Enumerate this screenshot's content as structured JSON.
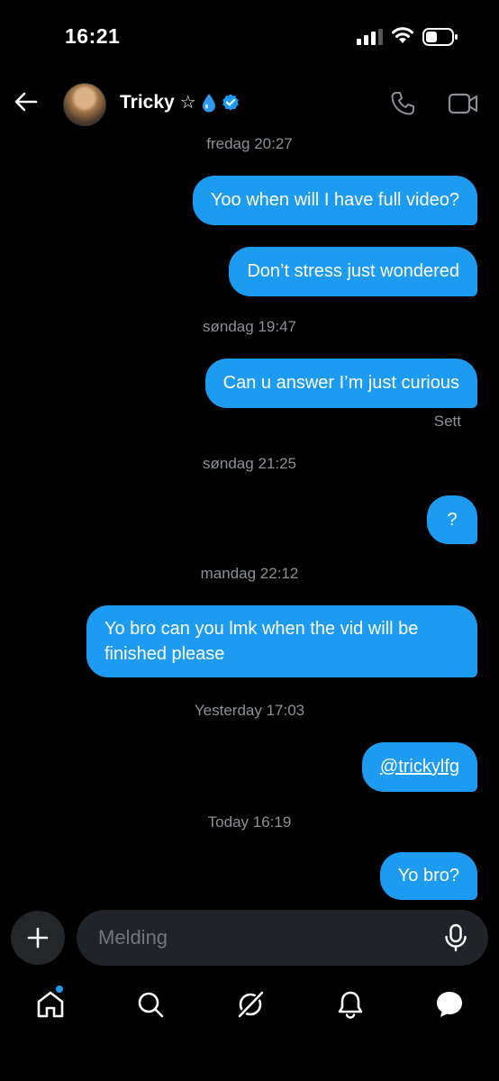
{
  "status_bar": {
    "time": "16:21"
  },
  "header": {
    "contact_name": "Tricky",
    "name_emoji_star": "☆",
    "verified": true
  },
  "messages": [
    {
      "type": "timestamp",
      "text": "fredag 20:27"
    },
    {
      "type": "sent",
      "text": "Yoo when will I have full video?"
    },
    {
      "type": "sent",
      "text": "Don’t stress just wondered"
    },
    {
      "type": "timestamp",
      "text": "søndag 19:47"
    },
    {
      "type": "sent",
      "text": "Can u answer I’m just curious"
    },
    {
      "type": "status",
      "text": "Sett"
    },
    {
      "type": "timestamp",
      "text": "søndag 21:25"
    },
    {
      "type": "sent",
      "text": "?"
    },
    {
      "type": "timestamp",
      "text": "mandag 22:12"
    },
    {
      "type": "sent",
      "text": "Yo bro can you lmk when the vid will be finished please"
    },
    {
      "type": "timestamp",
      "text": "Yesterday 17:03"
    },
    {
      "type": "sent",
      "text": "@trickylfg"
    },
    {
      "type": "timestamp",
      "text": "Today 16:19"
    },
    {
      "type": "sent",
      "text": "Yo bro?"
    }
  ],
  "composer": {
    "placeholder": "Melding"
  },
  "nav": {
    "items": [
      "home-icon",
      "search-icon",
      "grok-icon",
      "notifications-icon",
      "messages-icon"
    ],
    "home_has_notification_dot": true
  },
  "colors": {
    "accent": "#1d9bf0",
    "background": "#000000",
    "muted_text": "#8b9096"
  }
}
